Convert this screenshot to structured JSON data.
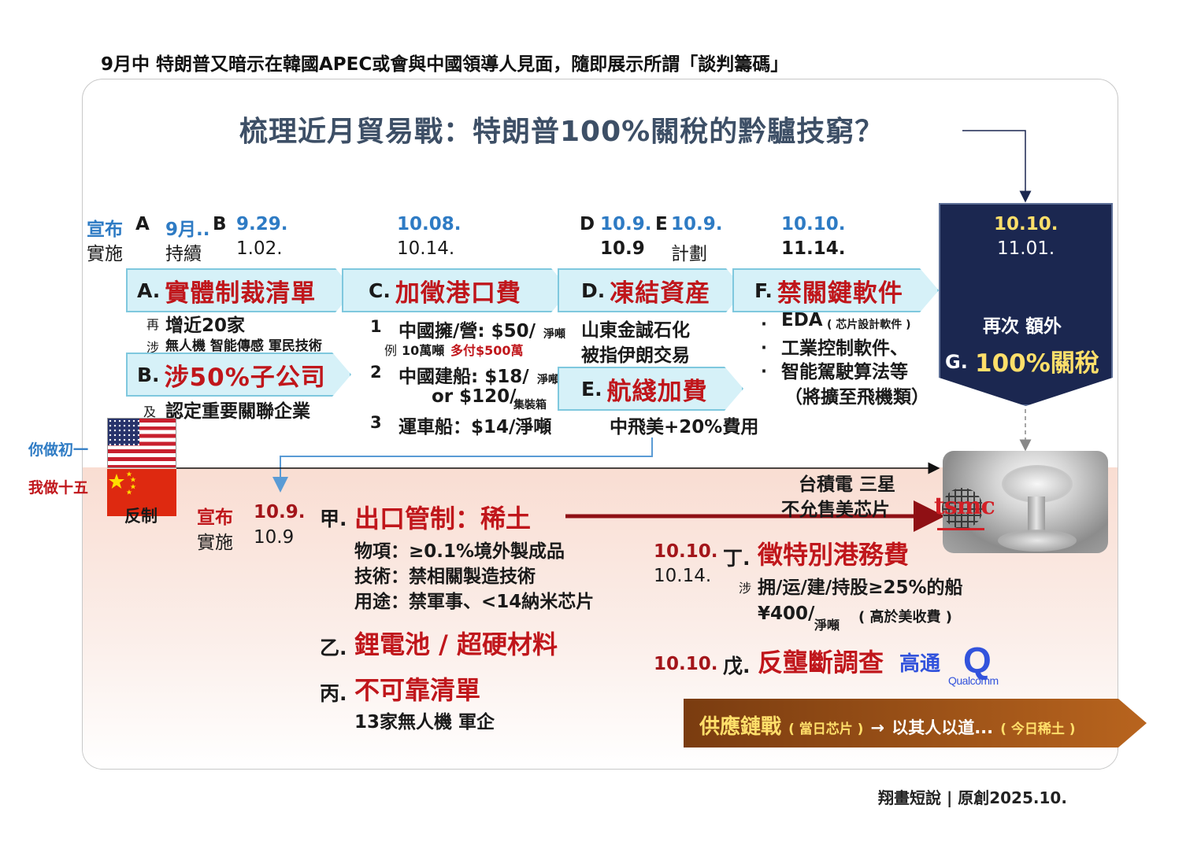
{
  "top_caption": "9月中 特朗普又暗示在韓國APEC或會與中國領導人見面，隨即展示所謂「談判籌碼」",
  "main_title": "梳理近月貿易戰：特朗普100%關稅的黔驢技窮？",
  "timeline": {
    "announce_label": "宣布",
    "implement_label": "實施",
    "a": {
      "letter": "A",
      "announce": "9月..",
      "implement": "持續"
    },
    "b": {
      "letter": "B",
      "announce": "9.29.",
      "implement": "1.02."
    },
    "c": {
      "announce": "10.08.",
      "implement": "10.14."
    },
    "d": {
      "letter": "D",
      "announce": "10.9.",
      "implement": "10.9"
    },
    "e": {
      "letter": "E",
      "announce": "10.9.",
      "implement": "計劃"
    },
    "f": {
      "announce": "10.10.",
      "implement": "11.14."
    },
    "g": {
      "announce": "10.10.",
      "implement": "11.01."
    }
  },
  "measures": {
    "a": {
      "letter": "A.",
      "title": "實體制裁清單",
      "prefix1": "再",
      "line1": "增近20家",
      "prefix2": "涉",
      "line2": "無人機  智能傳感  軍民技術"
    },
    "b": {
      "letter": "B.",
      "title": "涉50%子公司",
      "prefix1": "及",
      "line1": "認定重要關聯企業"
    },
    "c": {
      "letter": "C.",
      "title": "加徵港口費",
      "item1_num": "1",
      "item1": "中國擁/營: $50/",
      "item1_unit": "淨噸",
      "example_prefix": "例",
      "example_black": "10萬噸",
      "example_red": "多付$500萬",
      "item2_num": "2",
      "item2": "中國建船: $18/",
      "item2_unit": "淨噸",
      "item2b": "or  $120/",
      "item2b_unit": "集裝箱",
      "item3_num": "3",
      "item3": "運車船：$14/淨噸"
    },
    "d": {
      "letter": "D.",
      "title": "凍結資産",
      "line1": "山東金誠石化",
      "line2": "被指伊朗交易"
    },
    "e": {
      "letter": "E.",
      "title": "航綫加費",
      "line1": "中飛美+20%費用"
    },
    "f": {
      "letter": "F.",
      "title": "禁關鍵軟件",
      "bullet": "·",
      "item1": "EDA",
      "item1_note": "( 芯片設計軟件 )",
      "item2": "工業控制軟件、",
      "item3": "智能駕駛算法等",
      "item4": "（將擴至飛機類）"
    },
    "g": {
      "line1": "再次 額外",
      "letter": "G.",
      "title": "100%關稅"
    }
  },
  "sides": {
    "us_label": "你做初一",
    "cn_label": "我做十五",
    "counter_label": "反制"
  },
  "counter": {
    "announce_label": "宣布",
    "implement_label": "實施",
    "date_announce": "10.9.",
    "date_implement": "10.9",
    "jia": {
      "num": "甲.",
      "title": "出口管制：稀土",
      "line1": "物項：≥0.1%境外製成品",
      "line2": "技術：禁相關製造技術",
      "line3": "用途：禁軍事、<14納米芯片"
    },
    "yi": {
      "num": "乙.",
      "title": "鋰電池 / 超硬材料"
    },
    "bing": {
      "num": "丙.",
      "title": "不可靠清單",
      "line1": "13家無人機 軍企"
    },
    "ding": {
      "date_announce": "10.10.",
      "date_implement": "10.14.",
      "num": "丁.",
      "title": "徵特別港務費",
      "prefix": "涉",
      "line1": "拥/运/建/持股≥25%的船",
      "line2": "¥400/",
      "line2_unit": "淨噸",
      "line2_note": "( 高於美收費 )"
    },
    "wu": {
      "date": "10.10.",
      "num": "戊.",
      "title": "反壟斷調查",
      "company": "高通"
    }
  },
  "tsmc_note": {
    "line1": "台積電 三星",
    "line2": "不允售美芯片"
  },
  "logos": {
    "tsmc": "tsmc",
    "qualcomm_q": "Q",
    "qualcomm_word": "Qualcomm"
  },
  "supply_banner": {
    "part1": "供應鏈戰",
    "note1": "( 當日芯片 )",
    "arrow": "→",
    "part2": "以其人以道...",
    "note2": "( 今日稀土 )"
  },
  "footer": "翔畫短說 | 原創2025.10.",
  "colors": {
    "accent_red": "#c0161b",
    "accent_blue": "#2e7bc4",
    "navy_box": "#1b2750",
    "chevron_fill": "#d6f1f8",
    "chevron_border": "#7fc8de",
    "gold_text": "#ffdf6a",
    "banner_brown": "#8a4515"
  }
}
